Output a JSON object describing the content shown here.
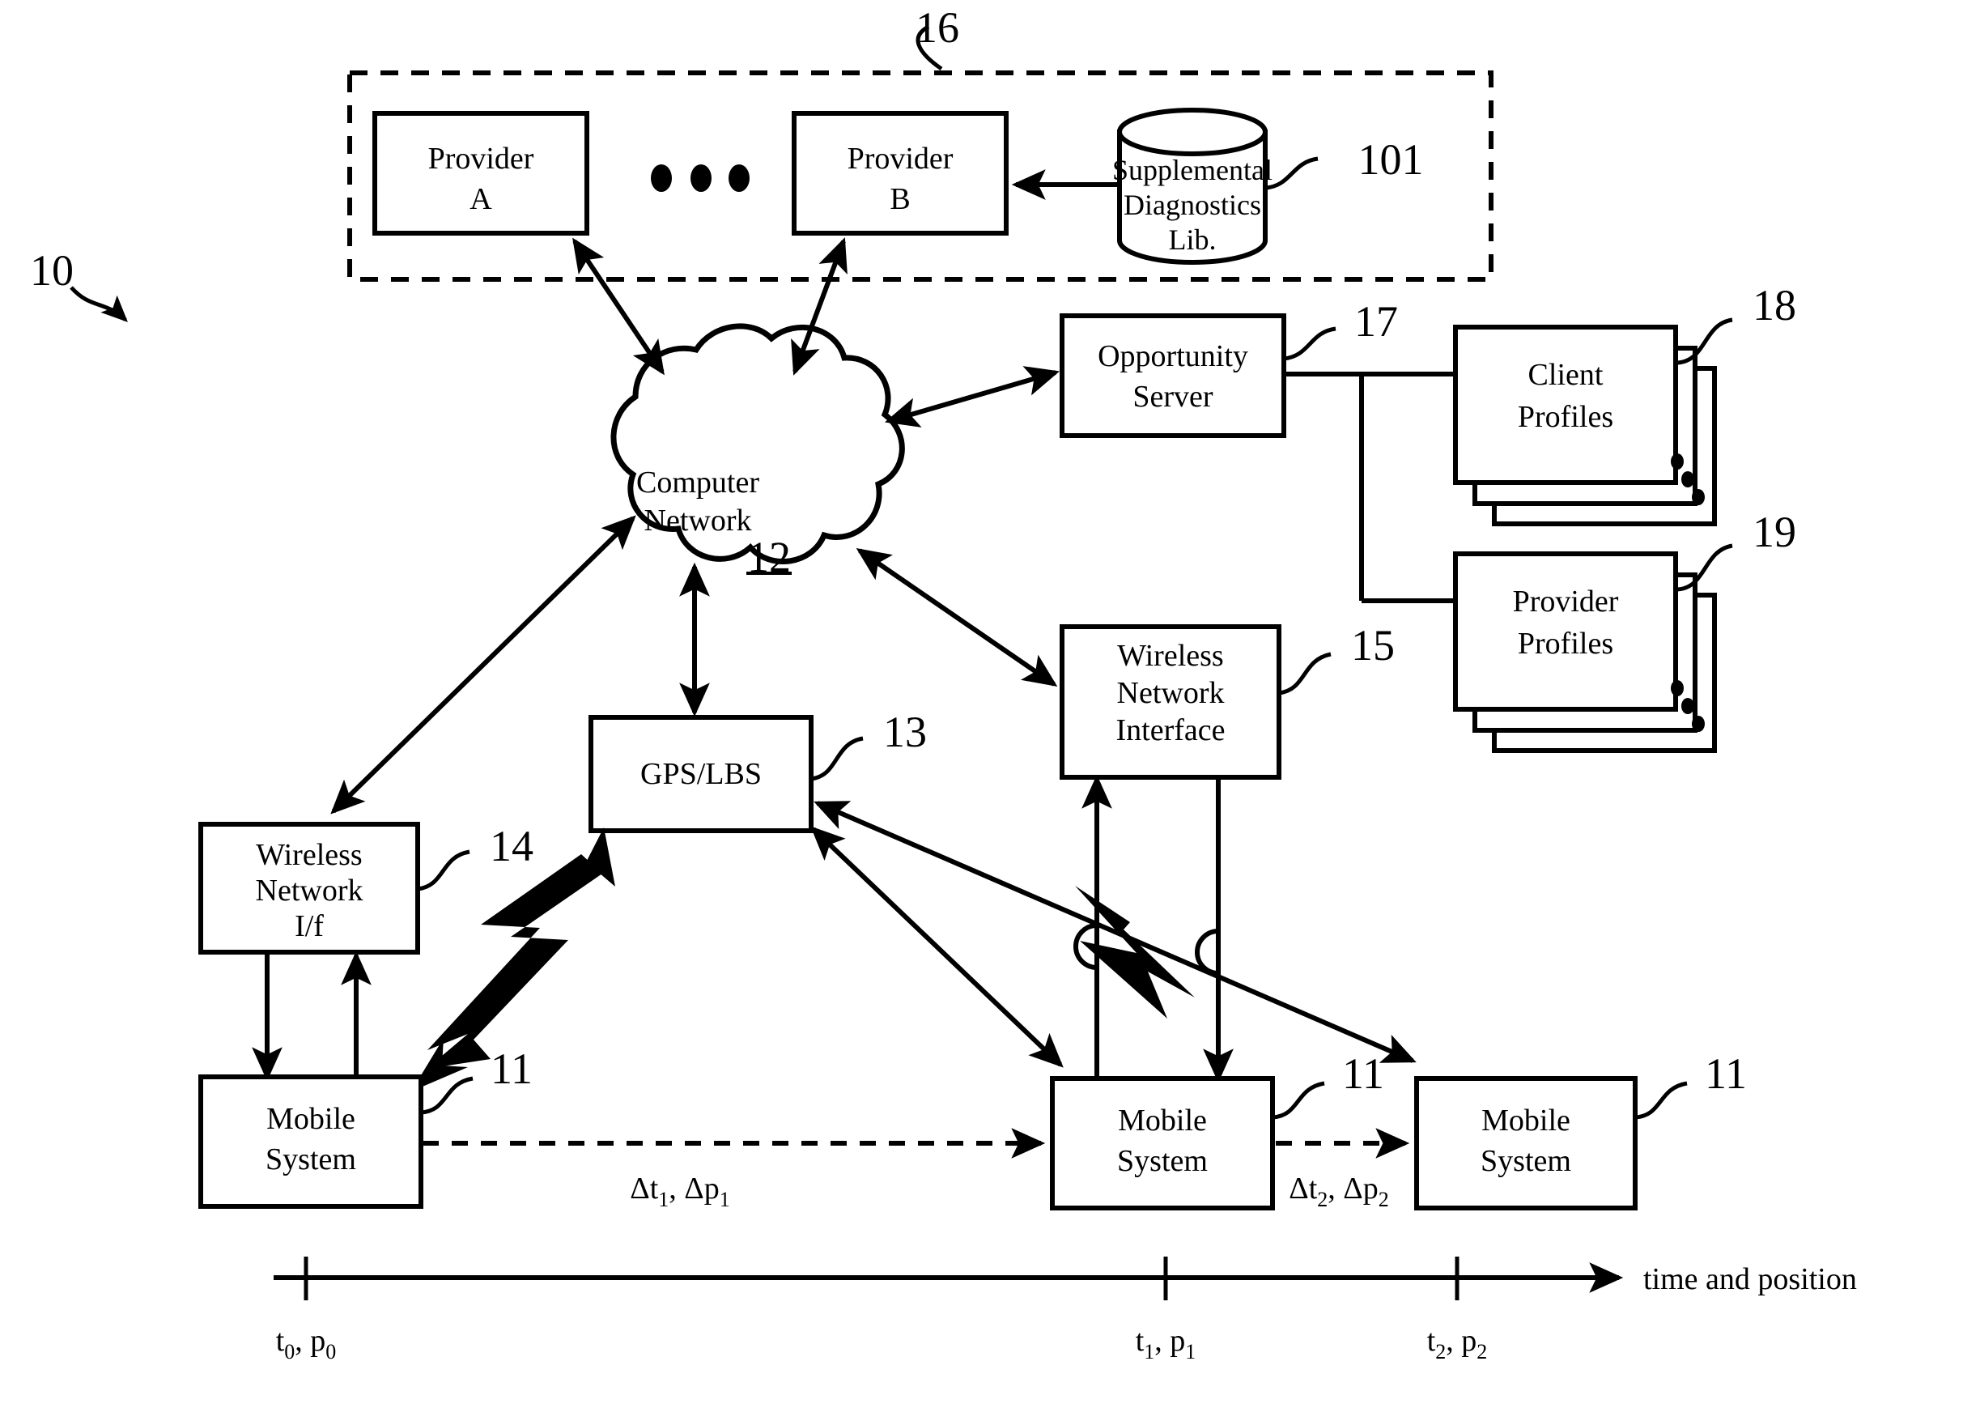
{
  "figure": {
    "title": "System architecture diagram",
    "overall_ref": "10"
  },
  "providers_region": {
    "ref": "16",
    "provider_a": "Provider\nA",
    "provider_a_line1": "Provider",
    "provider_a_line2": "A",
    "provider_b_line1": "Provider",
    "provider_b_line2": "B",
    "ellipsis_dots": 3,
    "supplemental_lib": {
      "ref": "101",
      "line1": "Supplemental",
      "line2": "Diagnostics",
      "line3": "Lib."
    }
  },
  "network": {
    "ref": "12",
    "line1": "Computer",
    "line2": "Network"
  },
  "opportunity_server": {
    "ref": "17",
    "line1": "Opportunity",
    "line2": "Server"
  },
  "client_profiles": {
    "ref": "18",
    "line1": "Client",
    "line2": "Profiles"
  },
  "provider_profiles": {
    "ref": "19",
    "line1": "Provider",
    "line2": "Profiles"
  },
  "wireless_network_interface": {
    "ref": "15",
    "line1": "Wireless",
    "line2": "Network",
    "line3": "Interface"
  },
  "wireless_network_if": {
    "ref": "14",
    "line1": "Wireless",
    "line2": "Network",
    "line3": "I/f"
  },
  "gps_lbs": {
    "ref": "13",
    "label": "GPS/LBS"
  },
  "mobile_systems": [
    {
      "ref": "11",
      "line1": "Mobile",
      "line2": "System"
    },
    {
      "ref": "11",
      "line1": "Mobile",
      "line2": "System"
    },
    {
      "ref": "11",
      "line1": "Mobile",
      "line2": "System"
    }
  ],
  "transitions": [
    {
      "symbol": "Δt",
      "sub1": "1",
      "symbol2": "Δp",
      "sub2": "1"
    },
    {
      "symbol": "Δt",
      "sub1": "2",
      "symbol2": "Δp",
      "sub2": "2"
    }
  ],
  "timeline": {
    "axis_label": "time and position",
    "ticks": [
      {
        "t": "t",
        "t_sub": "0",
        "p": "p",
        "p_sub": "0"
      },
      {
        "t": "t",
        "t_sub": "1",
        "p": "p",
        "p_sub": "1"
      },
      {
        "t": "t",
        "t_sub": "2",
        "p": "p",
        "p_sub": "2"
      }
    ]
  },
  "colors": {
    "ink": "#000000",
    "paper": "#ffffff"
  }
}
